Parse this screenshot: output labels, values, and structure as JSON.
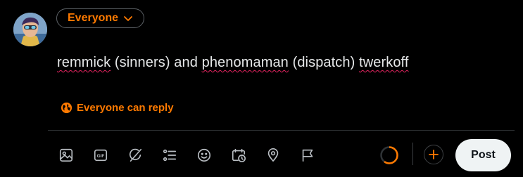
{
  "composer": {
    "audience_label": "Everyone",
    "text_segments": [
      {
        "text": "remmick",
        "spellcheck": true
      },
      {
        "text": " (sinners) and ",
        "spellcheck": false
      },
      {
        "text": "phenomaman",
        "spellcheck": true
      },
      {
        "text": " (dispatch) ",
        "spellcheck": false
      },
      {
        "text": "twerkoff",
        "spellcheck": true
      }
    ],
    "reply_setting": "Everyone can reply",
    "gif_label": "GIF",
    "character_progress": 0.6,
    "post_label": "Post"
  },
  "colors": {
    "accent": "#ff7a00",
    "background": "#000000",
    "text": "#e7e9ea",
    "icon": "#b9bec3",
    "divider": "#2f3336",
    "spellcheck_underline": "#e0245e",
    "post_button_bg": "#eff3f4",
    "post_button_text": "#0f1419"
  },
  "icons": {
    "toolbar": [
      "image-icon",
      "gif-icon",
      "grok-icon",
      "poll-icon",
      "emoji-icon",
      "schedule-icon",
      "location-icon",
      "flag-icon"
    ],
    "reply": "globe-icon",
    "audience": "chevron-down-icon",
    "add": "plus-icon"
  }
}
